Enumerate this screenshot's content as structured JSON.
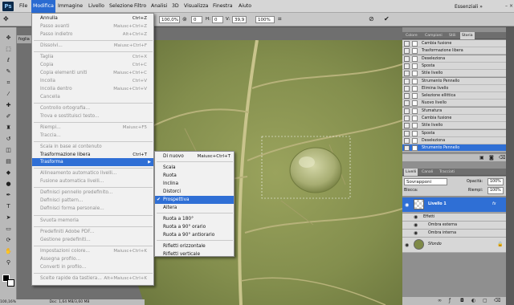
{
  "menubar": {
    "logo": "Ps",
    "items": [
      "File",
      "Modifica",
      "Immagine",
      "Livello",
      "Selezione",
      "Filtro",
      "Analisi",
      "3D",
      "Visualizza",
      "Finestra",
      "Aiuto"
    ],
    "workspace": "Essenziali"
  },
  "options": {
    "zoom": "100,0%",
    "angle_label": "0",
    "h_label": "H:",
    "h_value": "0",
    "v_label": "V:",
    "v_value": "39,9",
    "zoom2": "100%"
  },
  "document_tab": "foglia",
  "status_bar": {
    "zoom": "100,16%",
    "doc": "Doc: 1,64 MB/3,60 MB"
  },
  "edit_menu": {
    "items": [
      {
        "label": "Annulla",
        "shortcut": "Ctrl+Z",
        "disabled": false
      },
      {
        "label": "Passo avanti",
        "shortcut": "Maiusc+Ctrl+Z",
        "disabled": true
      },
      {
        "label": "Passo indietro",
        "shortcut": "Alt+Ctrl+Z",
        "disabled": true
      },
      {
        "label": "Dissolvi...",
        "shortcut": "Maiusc+Ctrl+F",
        "disabled": true
      },
      {
        "label": "Taglia",
        "shortcut": "Ctrl+X",
        "disabled": true
      },
      {
        "label": "Copia",
        "shortcut": "Ctrl+C",
        "disabled": true
      },
      {
        "label": "Copia elementi uniti",
        "shortcut": "Maiusc+Ctrl+C",
        "disabled": true
      },
      {
        "label": "Incolla",
        "shortcut": "Ctrl+V",
        "disabled": true
      },
      {
        "label": "Incolla dentro",
        "shortcut": "Maiusc+Ctrl+V",
        "disabled": true
      },
      {
        "label": "Cancella",
        "shortcut": "",
        "disabled": true
      },
      {
        "label": "Controllo ortografia...",
        "shortcut": "",
        "disabled": true
      },
      {
        "label": "Trova e sostituisci testo...",
        "shortcut": "",
        "disabled": true
      },
      {
        "label": "Riempi...",
        "shortcut": "Maiusc+F5",
        "disabled": true
      },
      {
        "label": "Traccia...",
        "shortcut": "",
        "disabled": true
      },
      {
        "label": "Scala in base al contenuto",
        "shortcut": "",
        "disabled": true
      },
      {
        "label": "Trasformazione libera",
        "shortcut": "Ctrl+T",
        "disabled": false
      },
      {
        "label": "Trasforma",
        "shortcut": "",
        "disabled": false
      },
      {
        "label": "Allineamento automatico livelli...",
        "shortcut": "",
        "disabled": true
      },
      {
        "label": "Fusione automatica livelli...",
        "shortcut": "",
        "disabled": true
      },
      {
        "label": "Definisci pennello predefinito...",
        "shortcut": "",
        "disabled": true
      },
      {
        "label": "Definisci pattern...",
        "shortcut": "",
        "disabled": true
      },
      {
        "label": "Definisci forma personale...",
        "shortcut": "",
        "disabled": true
      },
      {
        "label": "Svuota memoria",
        "shortcut": "",
        "disabled": true
      },
      {
        "label": "Predefiniti Adobe PDF...",
        "shortcut": "",
        "disabled": true
      },
      {
        "label": "Gestione predefiniti...",
        "shortcut": "",
        "disabled": true
      },
      {
        "label": "Impostazioni colore...",
        "shortcut": "Maiusc+Ctrl+K",
        "disabled": true
      },
      {
        "label": "Assegna profilo...",
        "shortcut": "",
        "disabled": true
      },
      {
        "label": "Converti in profilo...",
        "shortcut": "",
        "disabled": true
      },
      {
        "label": "Scelte rapide da tastiera...",
        "shortcut": "Alt+Maiusc+Ctrl+K",
        "disabled": true
      },
      {
        "label": "Menu...",
        "shortcut": "Alt+Maiusc+Ctrl+M",
        "disabled": true
      },
      {
        "label": "Preferenze",
        "shortcut": "",
        "disabled": true
      }
    ]
  },
  "transform_menu": {
    "items": [
      {
        "label": "Di nuovo",
        "shortcut": "Maiusc+Ctrl+T"
      },
      {
        "label": "Scala",
        "shortcut": ""
      },
      {
        "label": "Ruota",
        "shortcut": ""
      },
      {
        "label": "Inclina",
        "shortcut": ""
      },
      {
        "label": "Distorci",
        "shortcut": ""
      },
      {
        "label": "Prospettiva",
        "shortcut": ""
      },
      {
        "label": "Altera",
        "shortcut": ""
      },
      {
        "label": "Ruota a 180°",
        "shortcut": ""
      },
      {
        "label": "Ruota a 90° orario",
        "shortcut": ""
      },
      {
        "label": "Ruota a 90° antiorario",
        "shortcut": ""
      },
      {
        "label": "Rifletti orizzontale",
        "shortcut": ""
      },
      {
        "label": "Rifletti verticale",
        "shortcut": ""
      }
    ]
  },
  "history_panel": {
    "tabs": [
      "Colore",
      "Campioni",
      "Stili",
      "Storia"
    ],
    "items": [
      "Cambia fusione",
      "Trasformazione libera",
      "Deseleziona",
      "Sposta",
      "Stile livello",
      "Strumento Pennello",
      "Elimina livello",
      "Selezione ellittica",
      "Nuovo livello",
      "Sfumatura",
      "Cambia fusione",
      "Stile livello",
      "Sposta",
      "Deseleziona",
      "Strumento Pennello"
    ]
  },
  "layers_panel": {
    "tabs": [
      "Livelli",
      "Canali",
      "Tracciati"
    ],
    "blend_mode": "Sovrapponi",
    "opacity_label": "Opacità:",
    "opacity_value": "100%",
    "lock_label": "Blocca:",
    "fill_label": "Riempi:",
    "fill_value": "100%",
    "layers": [
      {
        "name": "Livello 1",
        "fx": "fx"
      },
      {
        "name": "Effetti"
      },
      {
        "name": "Ombra esterna"
      },
      {
        "name": "Ombra interna"
      },
      {
        "name": "Sfondo"
      }
    ]
  },
  "colors": {
    "accent": "#2f6fd5",
    "leaf": "#8e9a55"
  }
}
